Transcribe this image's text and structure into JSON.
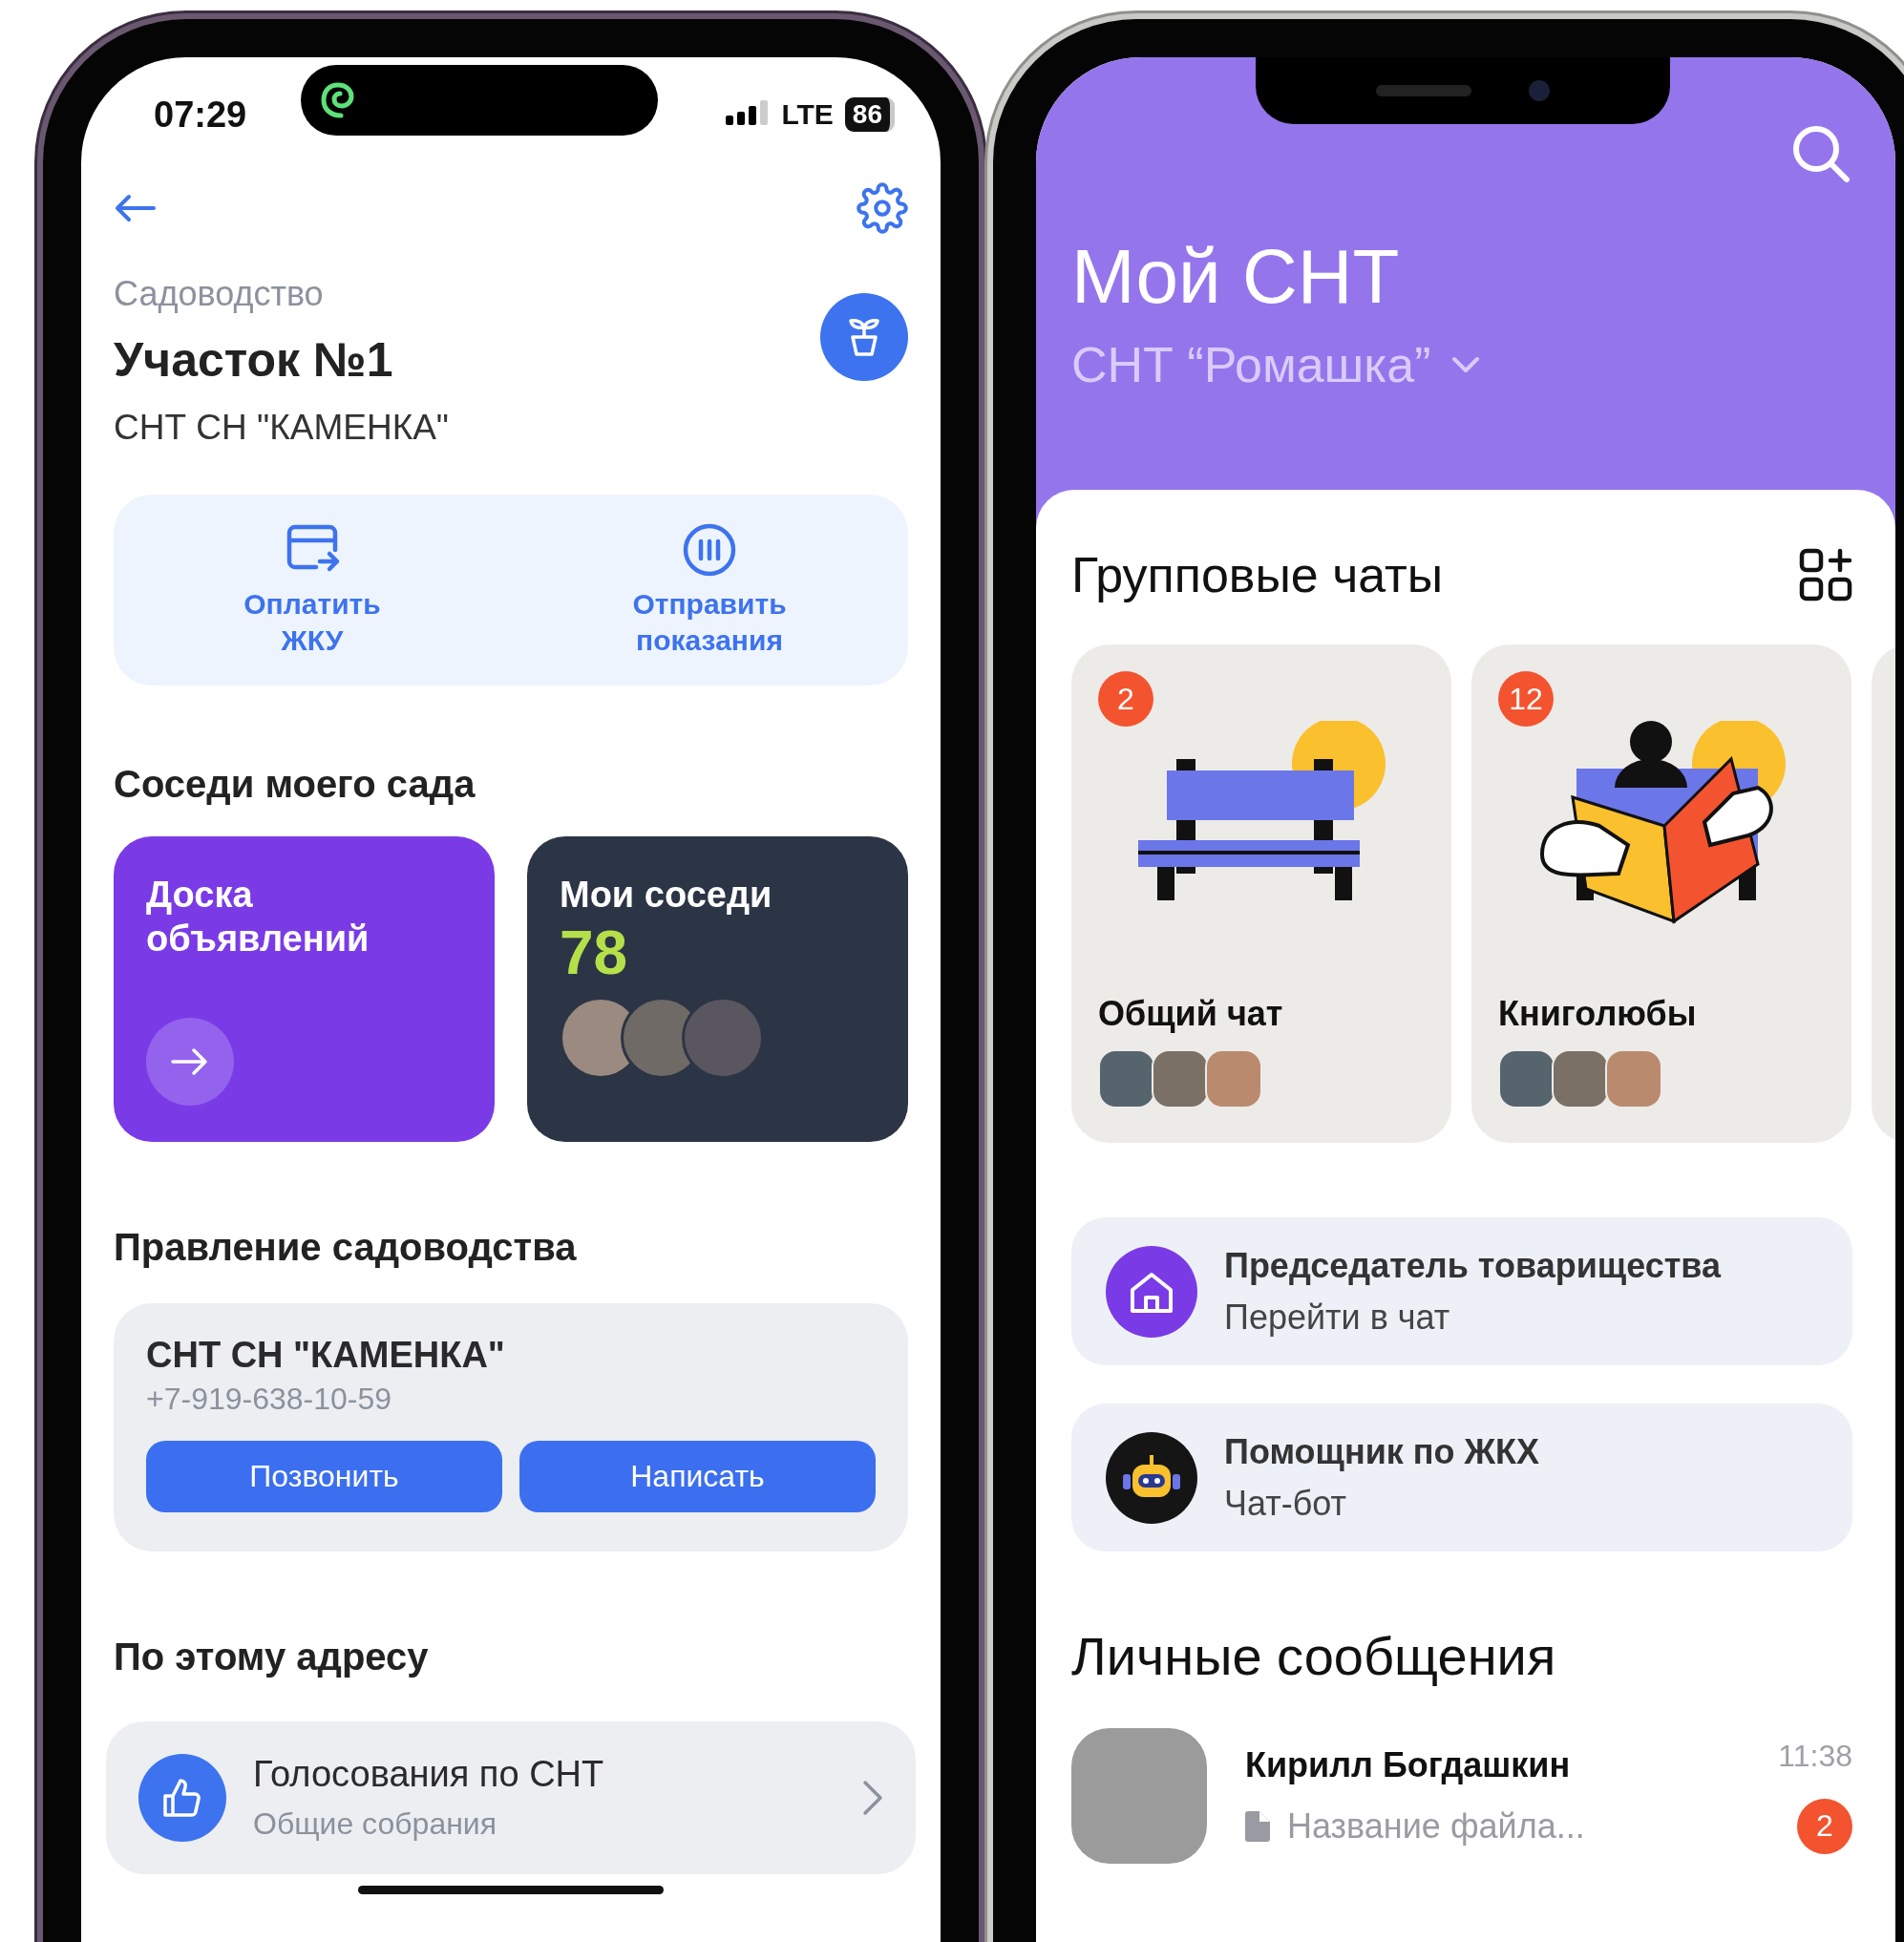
{
  "left_screen": {
    "status_bar": {
      "time": "07:29",
      "network": "LTE",
      "battery": "86"
    },
    "header": {
      "category": "Садоводство",
      "title": "Участок №1",
      "subtitle": "СНТ СН \"КАМЕНКА\""
    },
    "quick_actions": [
      {
        "label": "Оплатить ЖКУ",
        "kind": "payment"
      },
      {
        "label": "Отправить показания",
        "kind": "meter"
      }
    ],
    "neighbors": {
      "title": "Соседи моего сада",
      "board": {
        "label": "Доска объявлений"
      },
      "my_neighbors": {
        "label": "Мои соседи",
        "count": "78"
      }
    },
    "management": {
      "title": "Правление садоводства",
      "name": "СНТ СН \"КАМЕНКА\"",
      "phone": "+7-919-638-10-59",
      "buttons": [
        "Позвонить",
        "Написать"
      ]
    },
    "address": {
      "title": "По этому адресу",
      "item": {
        "title": "Голосования по СНТ",
        "subtitle": "Общие собрания"
      }
    }
  },
  "right_screen": {
    "title": "Мой СНТ",
    "community": "СНТ “Ромашка”",
    "group_chats": {
      "title": "Групповые чаты",
      "items": [
        {
          "name": "Общий чат",
          "unread": "2",
          "kind": "bench"
        },
        {
          "name": "Книголюбы",
          "unread": "12",
          "kind": "reader"
        }
      ]
    },
    "service_chats": [
      {
        "title": "Председатель товарищества",
        "subtitle": "Перейти в чат",
        "kind": "home"
      },
      {
        "title": "Помощник по ЖКХ",
        "subtitle": "Чат-бот",
        "kind": "bot"
      }
    ],
    "direct_messages": {
      "title": "Личные сообщения",
      "items": [
        {
          "name": "Кирилл Богдашкин",
          "preview": "Название файла...",
          "time": "11:38",
          "unread": "2"
        }
      ]
    }
  }
}
